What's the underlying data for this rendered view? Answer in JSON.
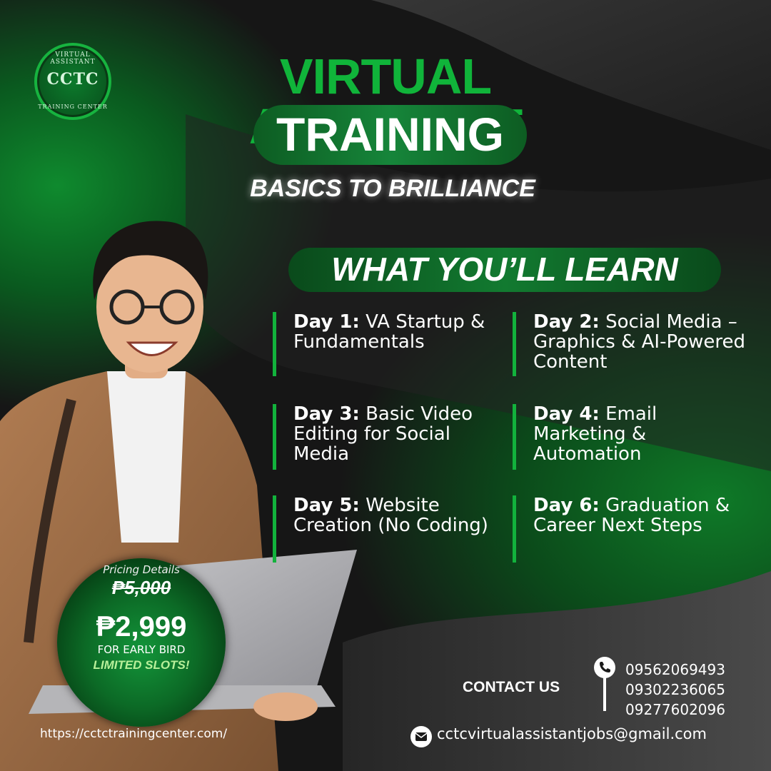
{
  "logo": {
    "initials": "CCTC",
    "ring_top": "VIRTUAL ASSISTANT",
    "ring_bottom": "TRAINING CENTER"
  },
  "header": {
    "title_line1": "VIRTUAL ASSISTANT",
    "title_line2": "TRAINING",
    "tagline": "BASICS TO BRILLIANCE"
  },
  "learn": {
    "heading": "WHAT YOU’LL LEARN",
    "days": [
      {
        "day": "Day 1:",
        "topic": "VA Startup & Fundamentals"
      },
      {
        "day": "Day 2:",
        "topic": "Social Media – Graphics & AI-Powered Content"
      },
      {
        "day": "Day 3:",
        "topic": "Basic Video Editing for Social Media"
      },
      {
        "day": "Day 4:",
        "topic": "Email Marketing & Automation"
      },
      {
        "day": "Day 5:",
        "topic": "Website Creation (No Coding)"
      },
      {
        "day": "Day 6:",
        "topic": "Graduation & Career Next Steps"
      }
    ]
  },
  "pricing": {
    "label": "Pricing Details",
    "old_price": "₱5,000",
    "new_price": "₱2,999",
    "note": "FOR EARLY BIRD",
    "slots": "LIMITED SLOTS!"
  },
  "contact": {
    "label": "CONTACT US",
    "phones": [
      "09562069493",
      "09302236065",
      "09277602096"
    ],
    "email": "cctcvirtualassistantjobs@gmail.com",
    "website": "https://cctctrainingcenter.com/"
  },
  "colors": {
    "accent_green": "#10b43a",
    "dark_green": "#0d5c22",
    "background": "#161616"
  },
  "icons": [
    "phone-icon",
    "mail-icon"
  ]
}
